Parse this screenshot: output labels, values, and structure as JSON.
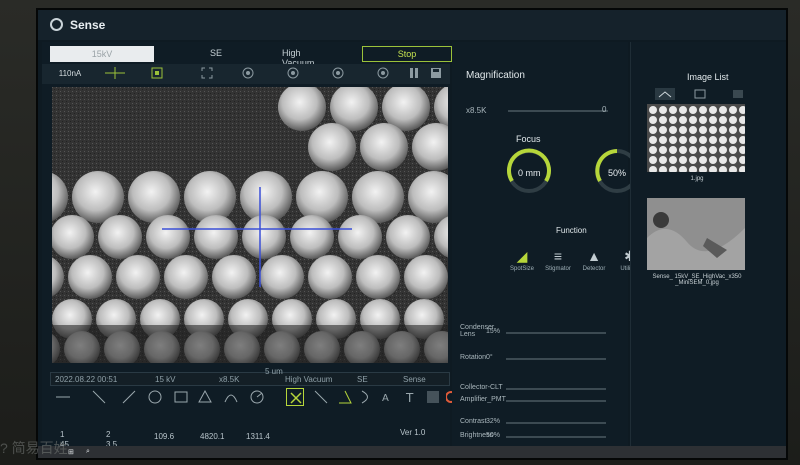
{
  "window": {
    "title": "Sense"
  },
  "topbar": {
    "kv": "15kV",
    "detector": "SE",
    "vacuum": "High Vacuum",
    "stop_label": "Stop"
  },
  "toolbar": {
    "current": "110nA"
  },
  "infobar": {
    "date": "2022.08.22 00:51",
    "kv": "15 kV",
    "mag": "x8.5K",
    "vac": "High Vacuum",
    "det": "SE",
    "mode": "Sense",
    "scale": "5 um"
  },
  "measurements": {
    "row1": [
      "1",
      "2",
      "109.6",
      "4820.1",
      "1311.4"
    ],
    "row2": [
      "45",
      "3.5"
    ],
    "version": "Ver 1.0"
  },
  "magnification": {
    "title": "Magnification",
    "value": "x8.5K",
    "center_mark": "0"
  },
  "focus": {
    "title": "Focus",
    "knob1": "0 mm",
    "knob2": "50%"
  },
  "function": {
    "title": "Function",
    "items": [
      {
        "label": "SpotSize",
        "icon": "spotsize-icon"
      },
      {
        "label": "Stigmator",
        "icon": "sliders-icon"
      },
      {
        "label": "Detector",
        "icon": "detector-icon"
      },
      {
        "label": "Utilities",
        "icon": "utilities-icon"
      }
    ]
  },
  "sliders": {
    "condenser_label": "Condenser Lens",
    "condenser_value": "15%",
    "rotation_label": "Rotation",
    "rotation_value": "0°",
    "collector_label": "Collector-CLT",
    "amplifier_label": "Amplifier_PMT",
    "contrast_label": "Contrast",
    "contrast_value": "32%",
    "brightness_label": "Brightness",
    "brightness_value": "50%"
  },
  "image_list": {
    "title": "Image List",
    "items": [
      {
        "caption": "1.jpg"
      },
      {
        "caption": "Sense_ 15kV_SE_HighVac_x350 _MiniSEM_0.jpg"
      }
    ]
  },
  "watermark": "? 简易百姓",
  "colors": {
    "accent": "#b6d63a",
    "panel": "#0f1c25",
    "crosshair": "#3a4fd6"
  }
}
